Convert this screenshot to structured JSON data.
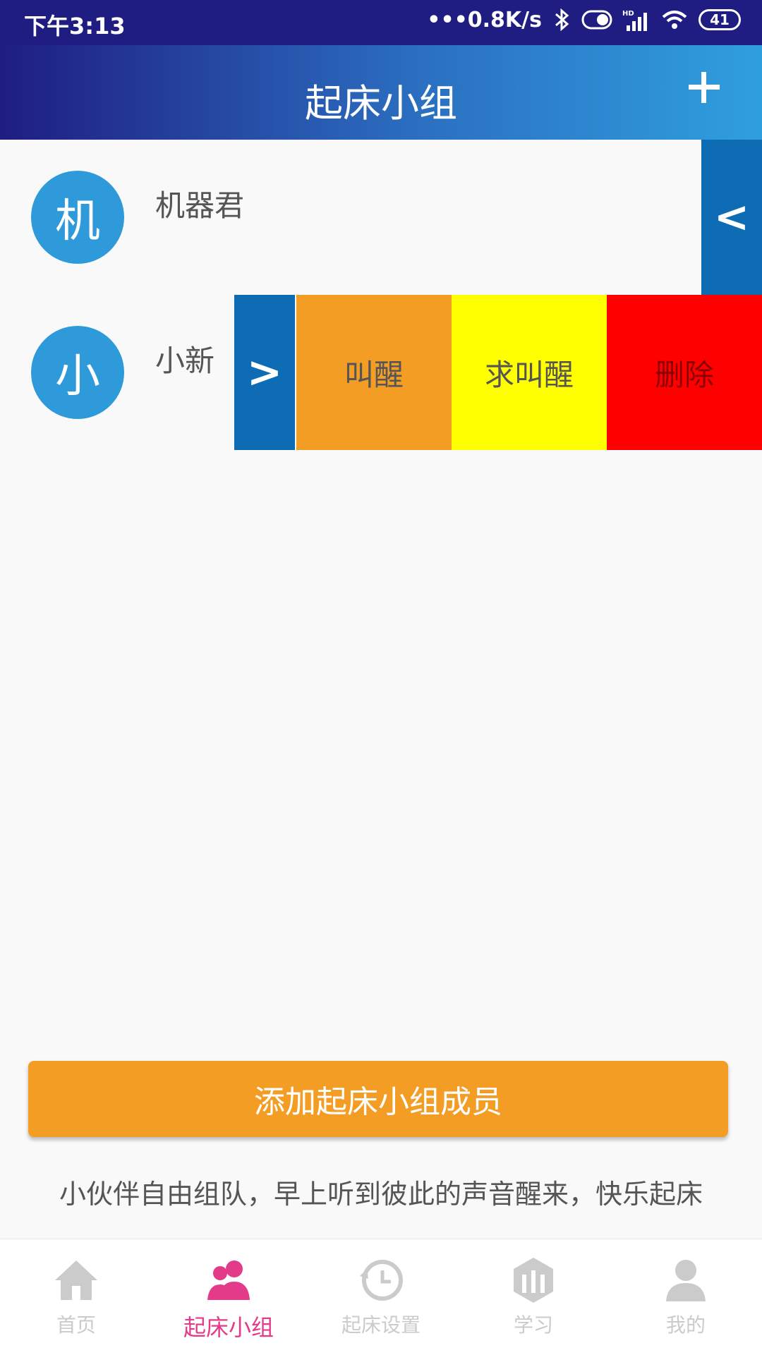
{
  "status": {
    "time": "下午3:13",
    "speed": "•••0.8K/s",
    "battery": "41"
  },
  "header": {
    "title": "起床小组"
  },
  "members": [
    {
      "avatar": "机",
      "name": "机器君",
      "toggle": "<"
    },
    {
      "avatar": "小",
      "name": "小新",
      "toggle": ">"
    }
  ],
  "actions": {
    "wake": "叫醒",
    "ask_wake": "求叫醒",
    "delete": "删除"
  },
  "button": {
    "add_member": "添加起床小组成员"
  },
  "description": "小伙伴自由组队，早上听到彼此的声音醒来，快乐起床",
  "tabs": [
    {
      "label": "首页",
      "icon": "home-icon"
    },
    {
      "label": "起床小组",
      "icon": "group-icon"
    },
    {
      "label": "起床设置",
      "icon": "clock-icon"
    },
    {
      "label": "学习",
      "icon": "study-icon"
    },
    {
      "label": "我的",
      "icon": "user-icon"
    }
  ],
  "colors": {
    "header_start": "#1f1d82",
    "header_end": "#2f9fdf",
    "avatar": "#2f9ad9",
    "toggle": "#0d6cb4",
    "wake": "#f39d24",
    "ask_wake": "#ffff00",
    "delete": "#ff0000",
    "active_tab": "#e33b8a",
    "inactive_tab": "#cbcbcb"
  }
}
